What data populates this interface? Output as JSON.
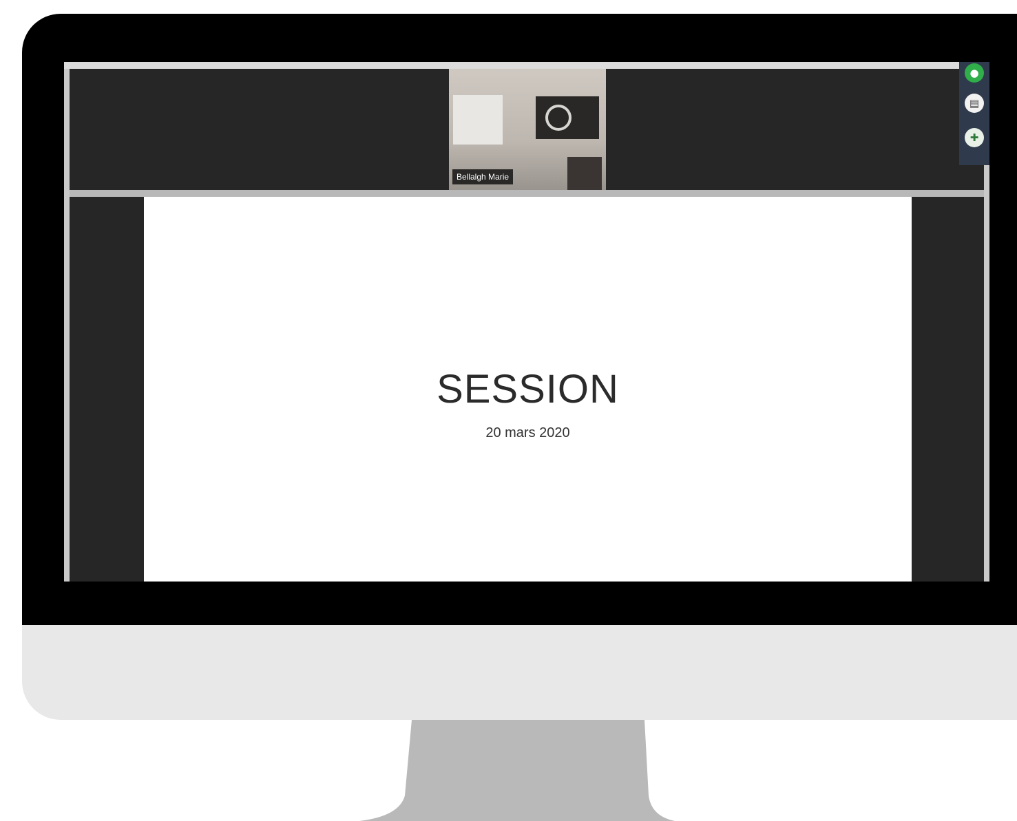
{
  "participant": {
    "name": "Bellalgh Marie"
  },
  "slide": {
    "title": "SESSION",
    "subtitle": "20 mars 2020"
  },
  "controls": [
    {
      "icon": "microphone-icon"
    },
    {
      "icon": "chat-icon"
    },
    {
      "icon": "share-icon"
    }
  ],
  "colors": {
    "bezel": "#000000",
    "chin": "#e8e8e8",
    "stand": "#b9b9b9",
    "app_background": "#262626",
    "mic_active": "#2fae4a"
  }
}
